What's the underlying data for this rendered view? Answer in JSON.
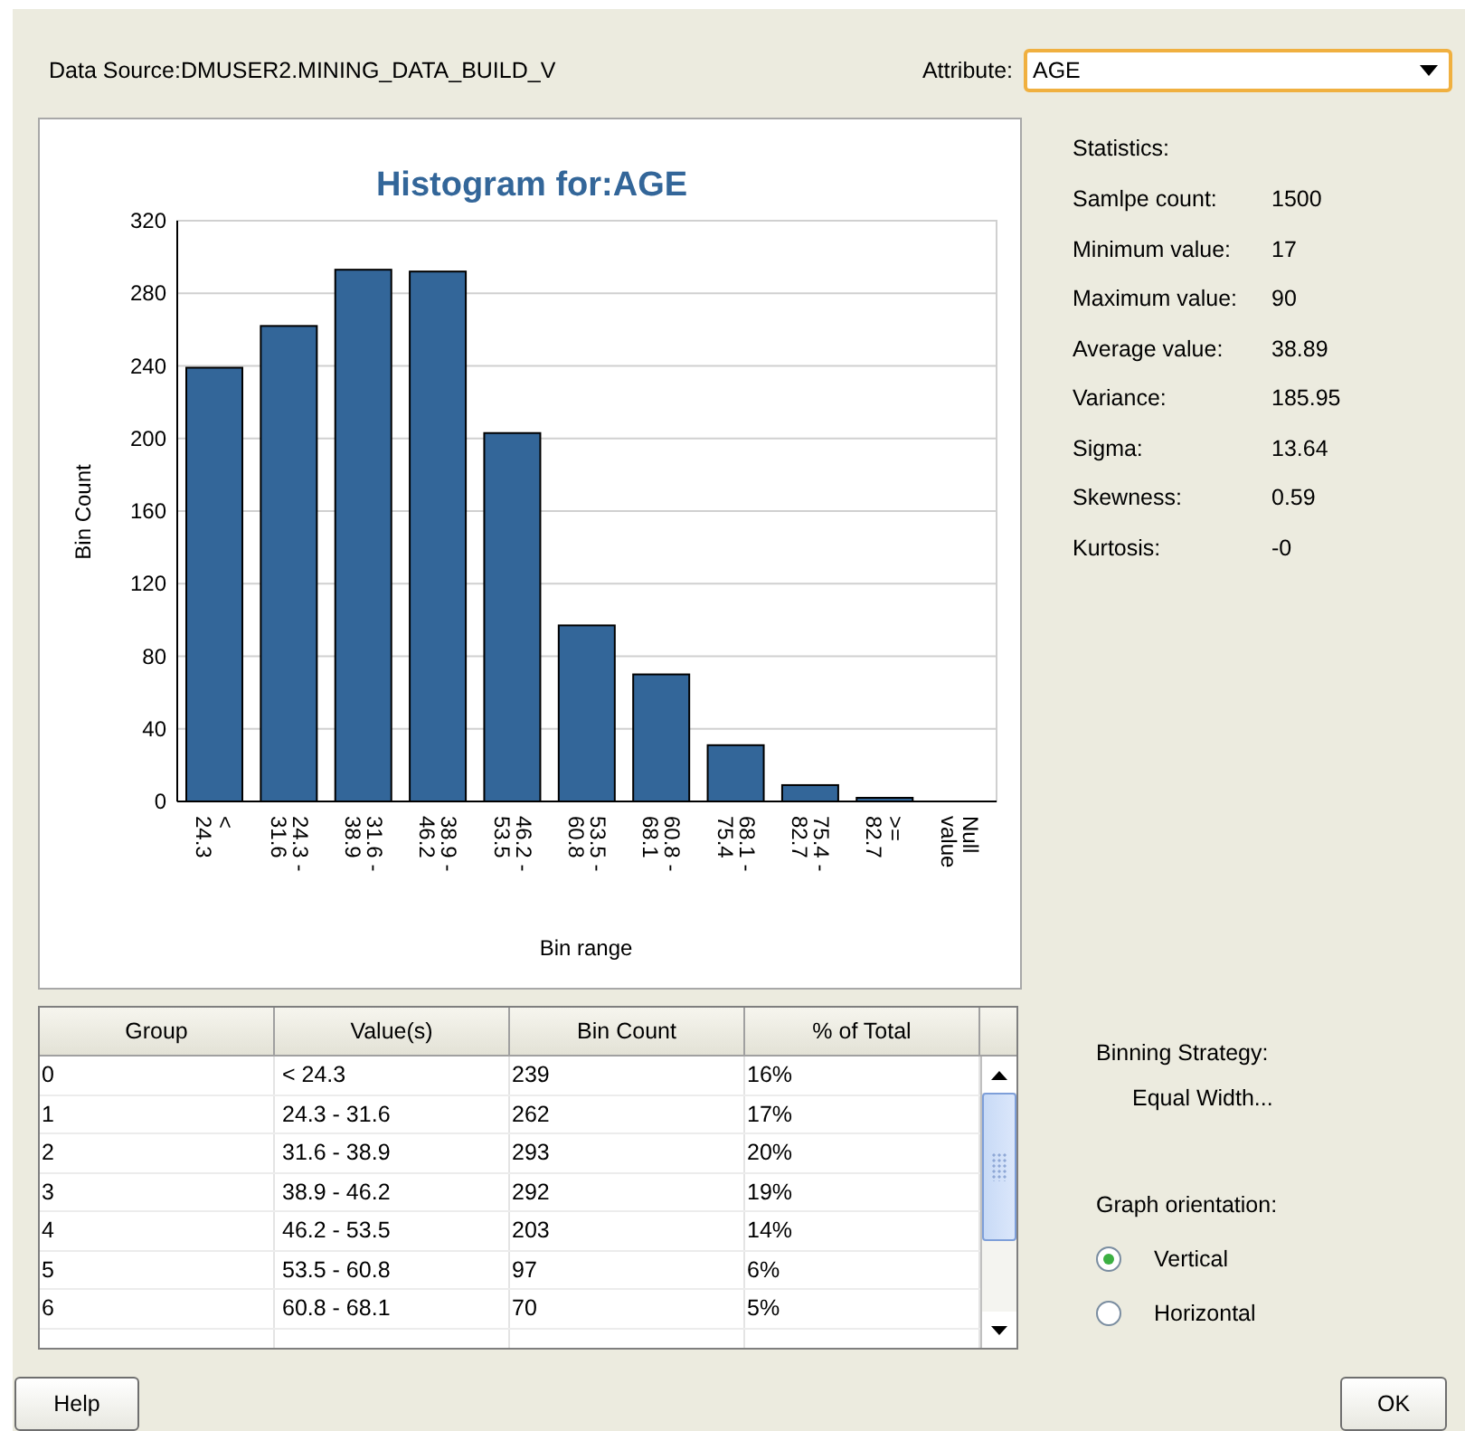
{
  "data_source": "Data Source:DMUSER2.MINING_DATA_BUILD_V",
  "attribute": {
    "label": "Attribute:",
    "value": "AGE"
  },
  "chart": {
    "chart_data": {
      "type": "bar",
      "title": "Histogram for:AGE",
      "xlabel": "Bin range",
      "ylabel": "Bin Count",
      "categories": [
        "< 24.3",
        "24.3 - 31.6",
        "31.6 - 38.9",
        "38.9 - 46.2",
        "46.2 - 53.5",
        "53.5 - 60.8",
        "60.8 - 68.1",
        "68.1 - 75.4",
        "75.4 - 82.7",
        ">= 82.7",
        "Null value"
      ],
      "series": [
        {
          "color": "#336699",
          "values": [
            239,
            262,
            293,
            292,
            203,
            97,
            70,
            31,
            9,
            2,
            0
          ]
        }
      ],
      "grid": true,
      "ylim": [
        0,
        320
      ],
      "yticks": [
        0,
        40,
        80,
        120,
        160,
        200,
        240,
        280,
        320
      ]
    }
  },
  "statistics": {
    "title": "Statistics:",
    "rows": [
      {
        "label": "Samlpe count:",
        "value": "1500"
      },
      {
        "label": "Minimum value:",
        "value": "17"
      },
      {
        "label": "Maximum value:",
        "value": "90"
      },
      {
        "label": "Average value:",
        "value": "38.89"
      },
      {
        "label": "Variance:",
        "value": "185.95"
      },
      {
        "label": "Sigma:",
        "value": "13.64"
      },
      {
        "label": "Skewness:",
        "value": "0.59"
      },
      {
        "label": "Kurtosis:",
        "value": "-0"
      }
    ]
  },
  "table": {
    "columns": [
      "Group",
      "Value(s)",
      "Bin Count",
      "% of Total"
    ],
    "rows": [
      [
        "0",
        "< 24.3",
        "239",
        "16%"
      ],
      [
        "1",
        "24.3 - 31.6",
        "262",
        "17%"
      ],
      [
        "2",
        "31.6 - 38.9",
        "293",
        "20%"
      ],
      [
        "3",
        "38.9 - 46.2",
        "292",
        "19%"
      ],
      [
        "4",
        "46.2 - 53.5",
        "203",
        "14%"
      ],
      [
        "5",
        "53.5 - 60.8",
        "97",
        "6%"
      ],
      [
        "6",
        "60.8 - 68.1",
        "70",
        "5%"
      ]
    ]
  },
  "binning": {
    "label": "Binning Strategy:",
    "value": "Equal Width..."
  },
  "orientation": {
    "label": "Graph orientation:",
    "options": [
      {
        "label": "Vertical",
        "selected": true
      },
      {
        "label": "Horizontal",
        "selected": false
      }
    ]
  },
  "buttons": [
    {
      "label": "Help",
      "kind": "left"
    },
    {
      "label": "OK",
      "kind": "right"
    }
  ]
}
